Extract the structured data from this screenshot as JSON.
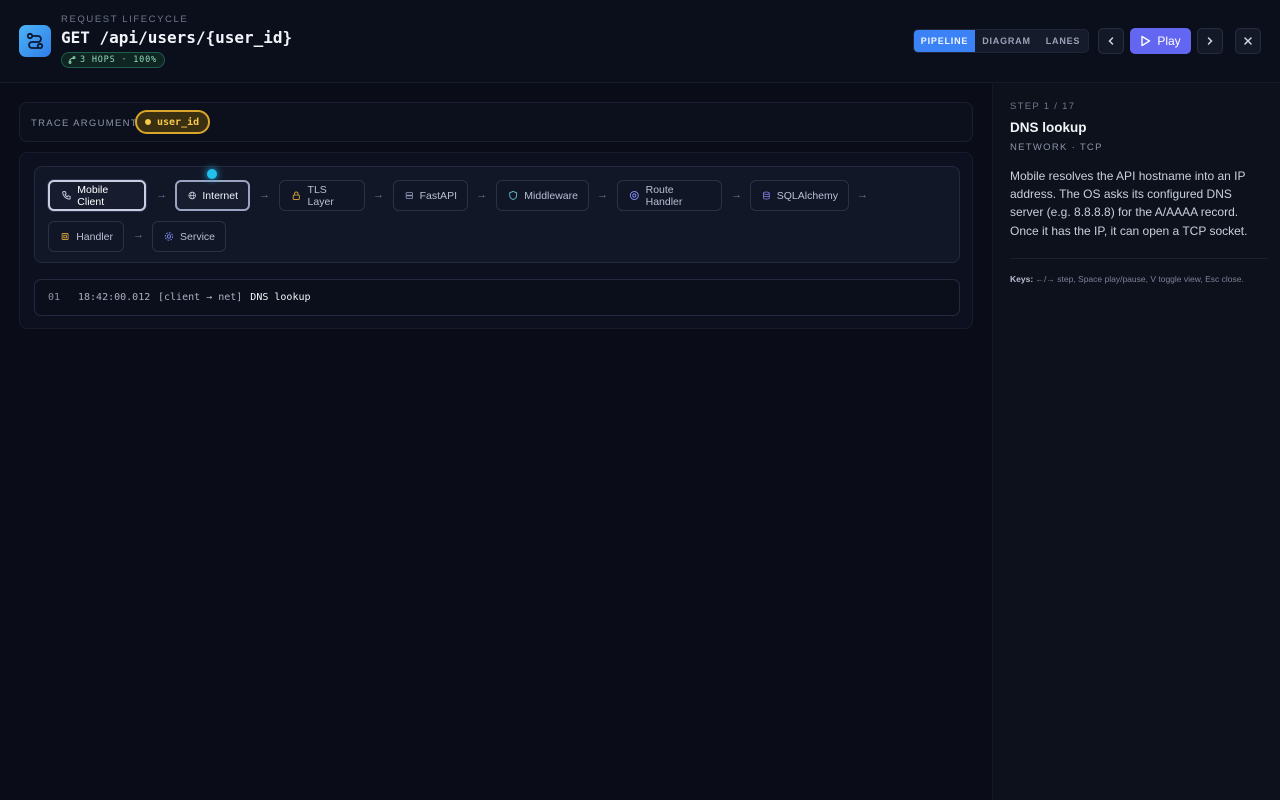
{
  "header": {
    "eyebrow": "REQUEST LIFECYCLE",
    "route": "GET /api/users/{user_id}",
    "hops_badge": "3 HOPS · 100%",
    "view_tabs": [
      "PIPELINE",
      "DIAGRAM",
      "LANES"
    ],
    "active_view": "PIPELINE",
    "play_label": "Play"
  },
  "trace": {
    "label": "TRACE ARGUMENT:",
    "argument": "user_id"
  },
  "pipeline": {
    "nodes": [
      {
        "label": "Mobile Client",
        "icon": "phone-icon",
        "state": "active"
      },
      {
        "label": "Internet",
        "icon": "globe-icon",
        "state": "hot"
      },
      {
        "label": "TLS Layer",
        "icon": "lock-icon",
        "state": "idle"
      },
      {
        "label": "FastAPI",
        "icon": "server-icon",
        "state": "idle"
      },
      {
        "label": "Middleware",
        "icon": "shield-icon",
        "state": "idle"
      },
      {
        "label": "Route Handler",
        "icon": "route-icon",
        "state": "idle"
      },
      {
        "label": "SQLAlchemy",
        "icon": "database-icon",
        "state": "idle"
      },
      {
        "label": "Handler",
        "icon": "chip-icon",
        "state": "idle"
      },
      {
        "label": "Service",
        "icon": "gear-icon",
        "state": "idle"
      }
    ]
  },
  "log": [
    {
      "num": "01",
      "time": "18:42:00.012",
      "tag": "[client → net]",
      "message": "DNS lookup"
    }
  ],
  "panel": {
    "step": "STEP 1 / 17",
    "title": "DNS lookup",
    "subtitle": "NETWORK · TCP",
    "body": "Mobile resolves the API hostname into an IP address. The OS asks its configured DNS server (e.g. 8.8.8.8) for the A/AAAA record. Once it has the IP, it can open a TCP socket.",
    "keys_label": "Keys:",
    "keys_text": " ←/→ step, Space play/pause, V toggle view, Esc close."
  },
  "colors": {
    "accent": "#6366f1",
    "view_active": "#3b82f6",
    "argument": "#f6c94b",
    "pulse": "#22c0ee",
    "hops": "#8fd9b8"
  }
}
